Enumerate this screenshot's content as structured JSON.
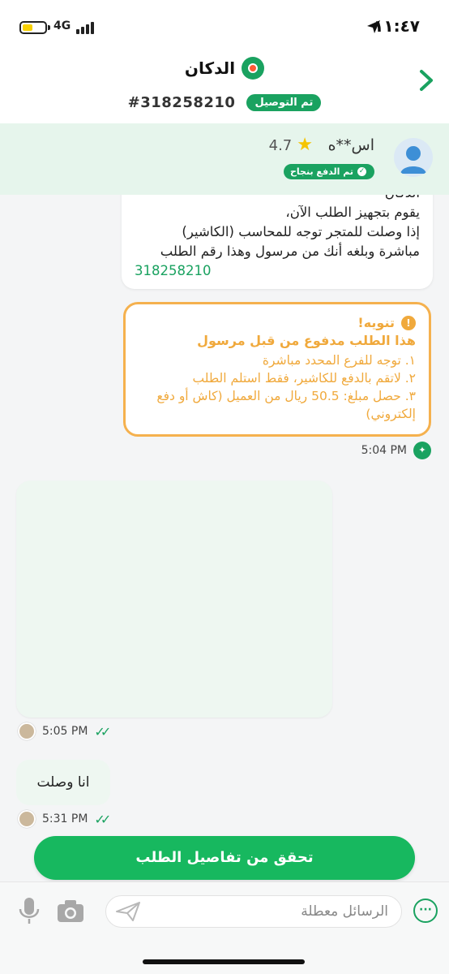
{
  "status_bar": {
    "network": "4G",
    "time": "١١:٤٧"
  },
  "header": {
    "store_name": "الدكان",
    "order_number": "#318258210",
    "delivery_status": "تم التوصيل"
  },
  "courier": {
    "name": "اس**ه",
    "rating": "4.7",
    "payment_status": "تم الدفع بنجاح"
  },
  "messages": {
    "store_message": {
      "partial_top": "الدكان",
      "line1": "يقوم بتجهيز الطلب الآن،",
      "line2": "إذا وصلت للمتجر توجه للمحاسب (الكاشير)",
      "line3": "مباشرة وبلغه أنك من مرسول وهذا رقم الطلب",
      "order_ref": "318258210"
    },
    "notice": {
      "title": "تنويه!",
      "subtitle": "هذا الطلب مدفوع من قبل مرسول",
      "item1": "١. توجه للفرع المحدد مباشرة",
      "item2": "٢. لاتقم بالدفع للكاشير، فقط استلم الطلب",
      "item3": "٣. حصل مبلغ: 50.5 ريال من العميل (كاش أو دفع إلكتروني)",
      "time": "5:04 PM"
    },
    "image_message": {
      "time": "5:05 PM"
    },
    "text_message": {
      "text": "انا وصلت",
      "time": "5:31 PM"
    }
  },
  "cta": {
    "label": "تحقق من تفاصيل الطلب"
  },
  "input_bar": {
    "placeholder": "الرسائل معطلة"
  },
  "colors": {
    "brand_green": "#1aa260",
    "notice_orange": "#f0a93c",
    "courier_bg": "#e6f5ec"
  }
}
